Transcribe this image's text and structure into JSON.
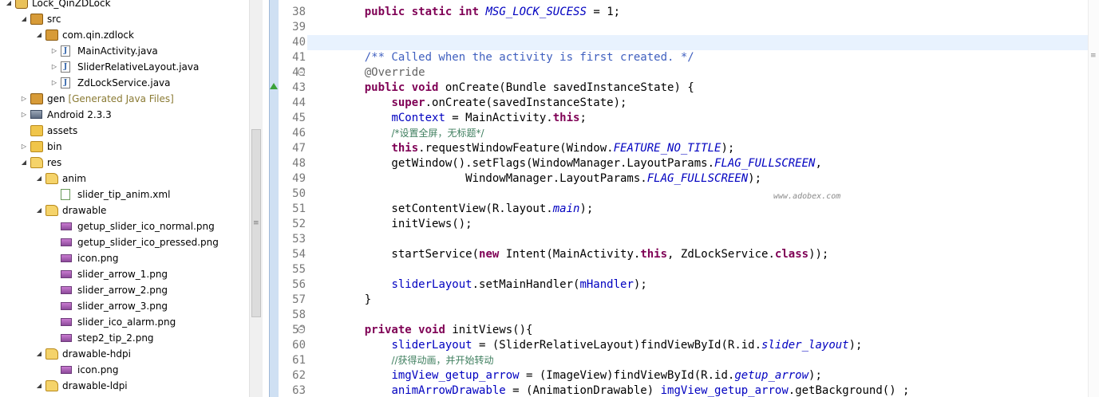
{
  "explorer": {
    "items": [
      {
        "label": "Lock_QinZDLock",
        "twisty": "◢",
        "icon": "project-icon"
      },
      {
        "label": "src",
        "twisty": "◢",
        "icon": "source-folder-icon"
      },
      {
        "label": "com.qin.zdlock",
        "twisty": "◢",
        "icon": "package-icon"
      },
      {
        "label": "MainActivity.java",
        "twisty": "▷",
        "icon": "java-file-icon"
      },
      {
        "label": "SliderRelativeLayout.java",
        "twisty": "▷",
        "icon": "java-file-icon"
      },
      {
        "label": "ZdLockService.java",
        "twisty": "▷",
        "icon": "java-file-icon"
      },
      {
        "label": "gen",
        "decoration": "[Generated Java Files]",
        "twisty": "▷",
        "icon": "source-folder-icon"
      },
      {
        "label": "Android 2.3.3",
        "twisty": "▷",
        "icon": "library-icon"
      },
      {
        "label": "assets",
        "twisty": "",
        "icon": "folder-icon"
      },
      {
        "label": "bin",
        "twisty": "▷",
        "icon": "folder-icon"
      },
      {
        "label": "res",
        "twisty": "◢",
        "icon": "folder-open-icon"
      },
      {
        "label": "anim",
        "twisty": "◢",
        "icon": "folder-open-icon"
      },
      {
        "label": "slider_tip_anim.xml",
        "twisty": "",
        "icon": "xml-file-icon"
      },
      {
        "label": "drawable",
        "twisty": "◢",
        "icon": "folder-open-icon"
      },
      {
        "label": "getup_slider_ico_normal.png",
        "twisty": "",
        "icon": "image-file-icon"
      },
      {
        "label": "getup_slider_ico_pressed.png",
        "twisty": "",
        "icon": "image-file-icon"
      },
      {
        "label": "icon.png",
        "twisty": "",
        "icon": "image-file-icon"
      },
      {
        "label": "slider_arrow_1.png",
        "twisty": "",
        "icon": "image-file-icon"
      },
      {
        "label": "slider_arrow_2.png",
        "twisty": "",
        "icon": "image-file-icon"
      },
      {
        "label": "slider_arrow_3.png",
        "twisty": "",
        "icon": "image-file-icon"
      },
      {
        "label": "slider_ico_alarm.png",
        "twisty": "",
        "icon": "image-file-icon"
      },
      {
        "label": "step2_tip_2.png",
        "twisty": "",
        "icon": "image-file-icon"
      },
      {
        "label": "drawable-hdpi",
        "twisty": "◢",
        "icon": "folder-open-icon"
      },
      {
        "label": "icon.png",
        "twisty": "",
        "icon": "image-file-icon"
      },
      {
        "label": "drawable-ldpi",
        "twisty": "◢",
        "icon": "folder-open-icon"
      }
    ]
  },
  "editor": {
    "watermark": "www.adobex.com",
    "lines": [
      {
        "n": "38",
        "fold": "",
        "code": "    public static int MSG_LOCK_SUCESS = 1;"
      },
      {
        "n": "39",
        "fold": "",
        "code": ""
      },
      {
        "n": "40",
        "fold": "",
        "code": ""
      },
      {
        "n": "41",
        "fold": "",
        "code": "    /** Called when the activity is first created. */"
      },
      {
        "n": "42",
        "fold": "⊖",
        "code": "    @Override"
      },
      {
        "n": "43",
        "fold": "",
        "code": "    public void onCreate(Bundle savedInstanceState) {"
      },
      {
        "n": "44",
        "fold": "",
        "code": "        super.onCreate(savedInstanceState);"
      },
      {
        "n": "45",
        "fold": "",
        "code": "        mContext = MainActivity.this;"
      },
      {
        "n": "46",
        "fold": "",
        "code": "        /*设置全屏，无标题*/"
      },
      {
        "n": "47",
        "fold": "",
        "code": "        this.requestWindowFeature(Window.FEATURE_NO_TITLE);"
      },
      {
        "n": "48",
        "fold": "",
        "code": "        getWindow().setFlags(WindowManager.LayoutParams.FLAG_FULLSCREEN,"
      },
      {
        "n": "49",
        "fold": "",
        "code": "                   WindowManager.LayoutParams.FLAG_FULLSCREEN);"
      },
      {
        "n": "50",
        "fold": "",
        "code": ""
      },
      {
        "n": "51",
        "fold": "",
        "code": "        setContentView(R.layout.main);"
      },
      {
        "n": "52",
        "fold": "",
        "code": "        initViews();"
      },
      {
        "n": "53",
        "fold": "",
        "code": ""
      },
      {
        "n": "54",
        "fold": "",
        "code": "        startService(new Intent(MainActivity.this, ZdLockService.class));"
      },
      {
        "n": "55",
        "fold": "",
        "code": ""
      },
      {
        "n": "56",
        "fold": "",
        "code": "        sliderLayout.setMainHandler(mHandler);"
      },
      {
        "n": "57",
        "fold": "",
        "code": "    }"
      },
      {
        "n": "58",
        "fold": "",
        "code": ""
      },
      {
        "n": "59",
        "fold": "⊖",
        "code": "    private void initViews(){"
      },
      {
        "n": "60",
        "fold": "",
        "code": "        sliderLayout = (SliderRelativeLayout)findViewById(R.id.slider_layout);"
      },
      {
        "n": "61",
        "fold": "",
        "code": "        //获得动画，并开始转动"
      },
      {
        "n": "62",
        "fold": "",
        "code": "        imgView_getup_arrow = (ImageView)findViewById(R.id.getup_arrow);"
      },
      {
        "n": "63",
        "fold": "",
        "code": "        animArrowDrawable = (AnimationDrawable) imgView_getup_arrow.getBackground() ;"
      }
    ]
  }
}
